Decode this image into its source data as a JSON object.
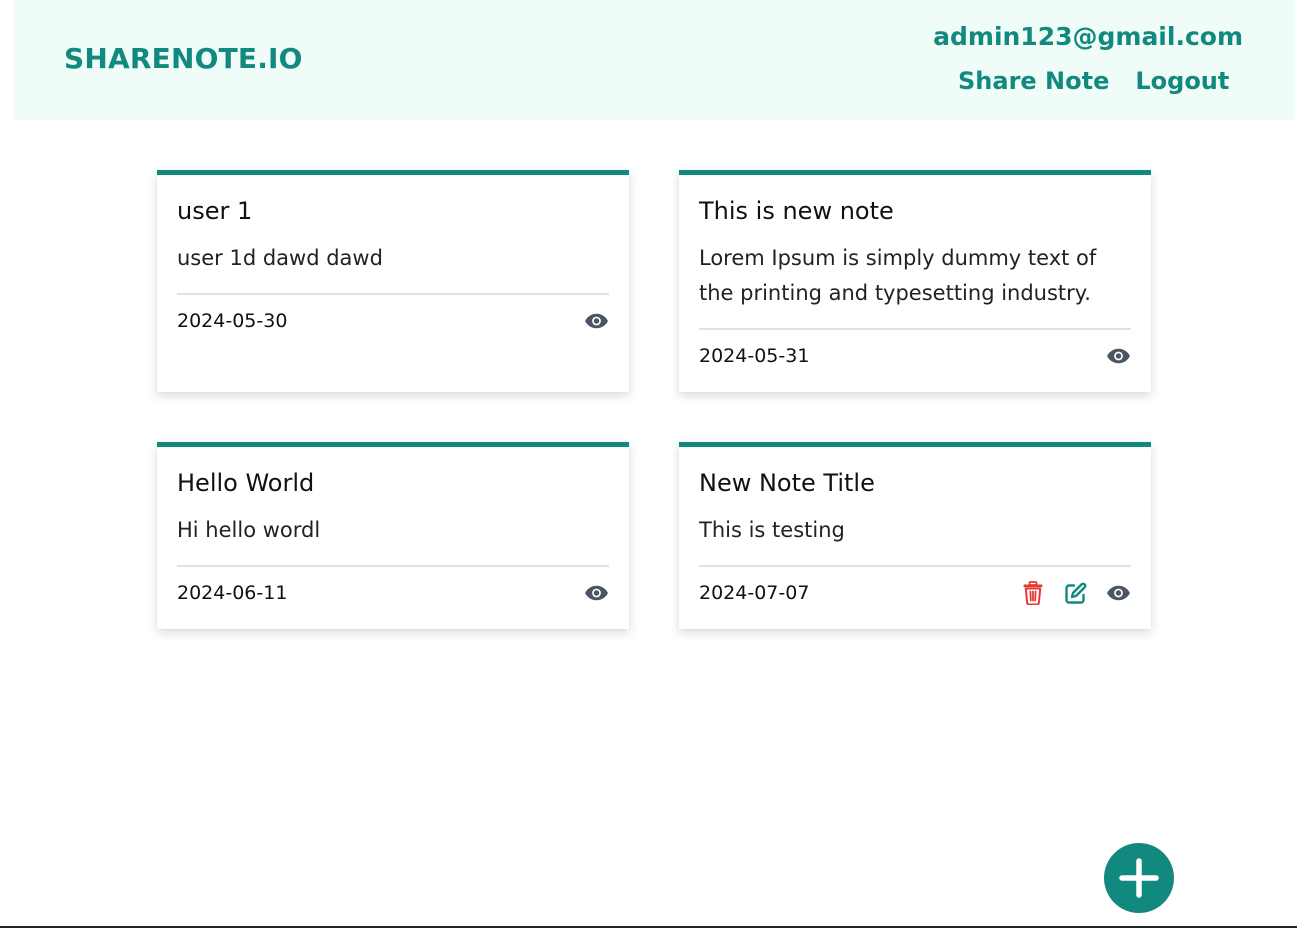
{
  "header": {
    "brand": "SHARENOTE.IO",
    "user_email": "admin123@gmail.com",
    "nav": {
      "share_note": "Share Note",
      "logout": "Logout"
    }
  },
  "notes": [
    {
      "title": "user 1",
      "body": "user 1d dawd dawd",
      "date": "2024-05-30",
      "actions": [
        "eye-icon"
      ]
    },
    {
      "title": "This is new note",
      "body": "Lorem Ipsum is simply dummy text of the printing and typesetting industry.",
      "date": "2024-05-31",
      "actions": [
        "eye-icon"
      ]
    },
    {
      "title": "Hello World",
      "body": "Hi hello wordl",
      "date": "2024-06-11",
      "actions": [
        "eye-icon"
      ]
    },
    {
      "title": "New Note Title",
      "body": "This is testing",
      "date": "2024-07-07",
      "actions": [
        "trash-icon",
        "edit-icon",
        "eye-icon"
      ]
    }
  ],
  "fab": {
    "icon": "plus-icon"
  },
  "colors": {
    "accent": "#12897f",
    "header_bg": "#effcf8",
    "delete": "#e53935",
    "view_icon": "#4b5563"
  }
}
